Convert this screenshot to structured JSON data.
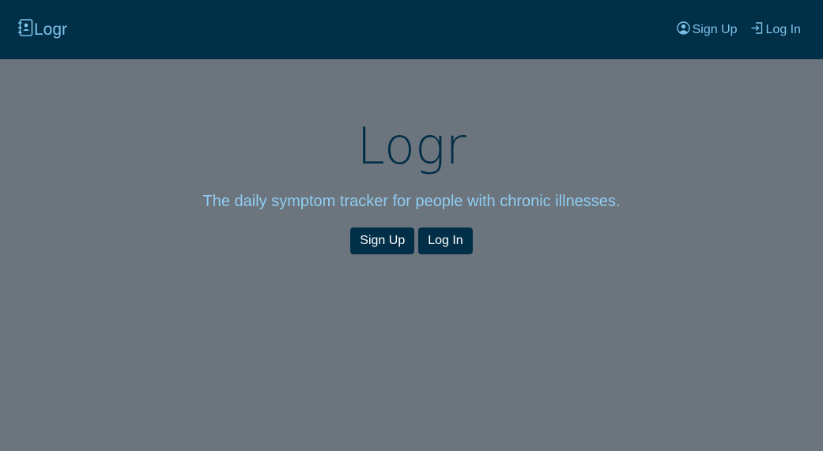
{
  "navbar": {
    "brand_label": "Logr",
    "links": [
      {
        "label": "Sign Up",
        "icon": "user-circle-icon"
      },
      {
        "label": "Log In",
        "icon": "login-icon"
      }
    ]
  },
  "hero": {
    "title": "Logr",
    "subtitle": "The daily symptom tracker for people with chronic illnesses.",
    "buttons": [
      {
        "label": "Sign Up"
      },
      {
        "label": "Log In"
      }
    ]
  },
  "colors": {
    "navbar_bg": "#012f47",
    "page_bg": "#6c757d",
    "accent_text": "#7fc3ea",
    "button_bg": "#012f47"
  }
}
